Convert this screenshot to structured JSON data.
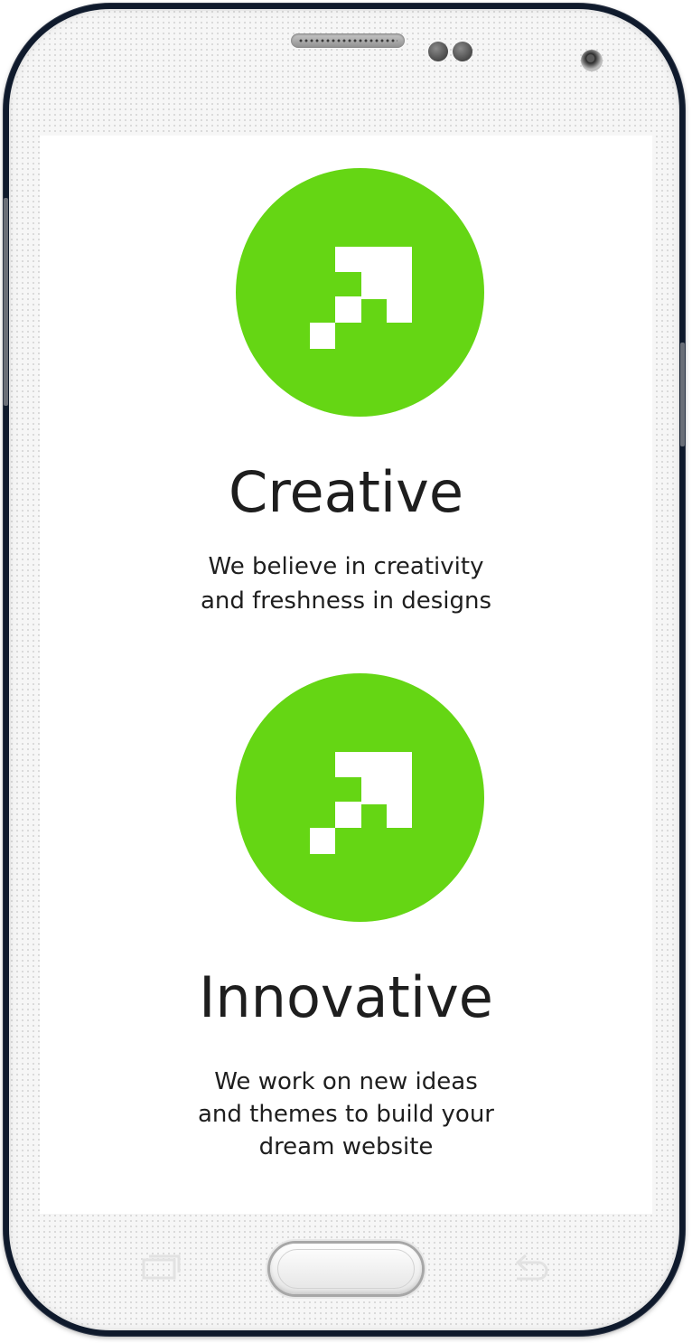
{
  "colors": {
    "accent": "#65d614",
    "text": "#1e1e1e",
    "screen_background": "#ffffff"
  },
  "features": [
    {
      "icon": "pixel-arrow-icon",
      "title": "Creative",
      "description_lines": [
        "We believe in creativity",
        "and freshness in designs"
      ]
    },
    {
      "icon": "pixel-arrow-icon",
      "title": "Innovative",
      "description_lines": [
        "We work on new ideas",
        "and themes to build your",
        "dream website"
      ]
    }
  ],
  "device_icons": [
    "speaker-grille-icon",
    "proximity-sensor-icon",
    "front-camera-icon",
    "recent-apps-icon",
    "home-button",
    "back-icon"
  ]
}
